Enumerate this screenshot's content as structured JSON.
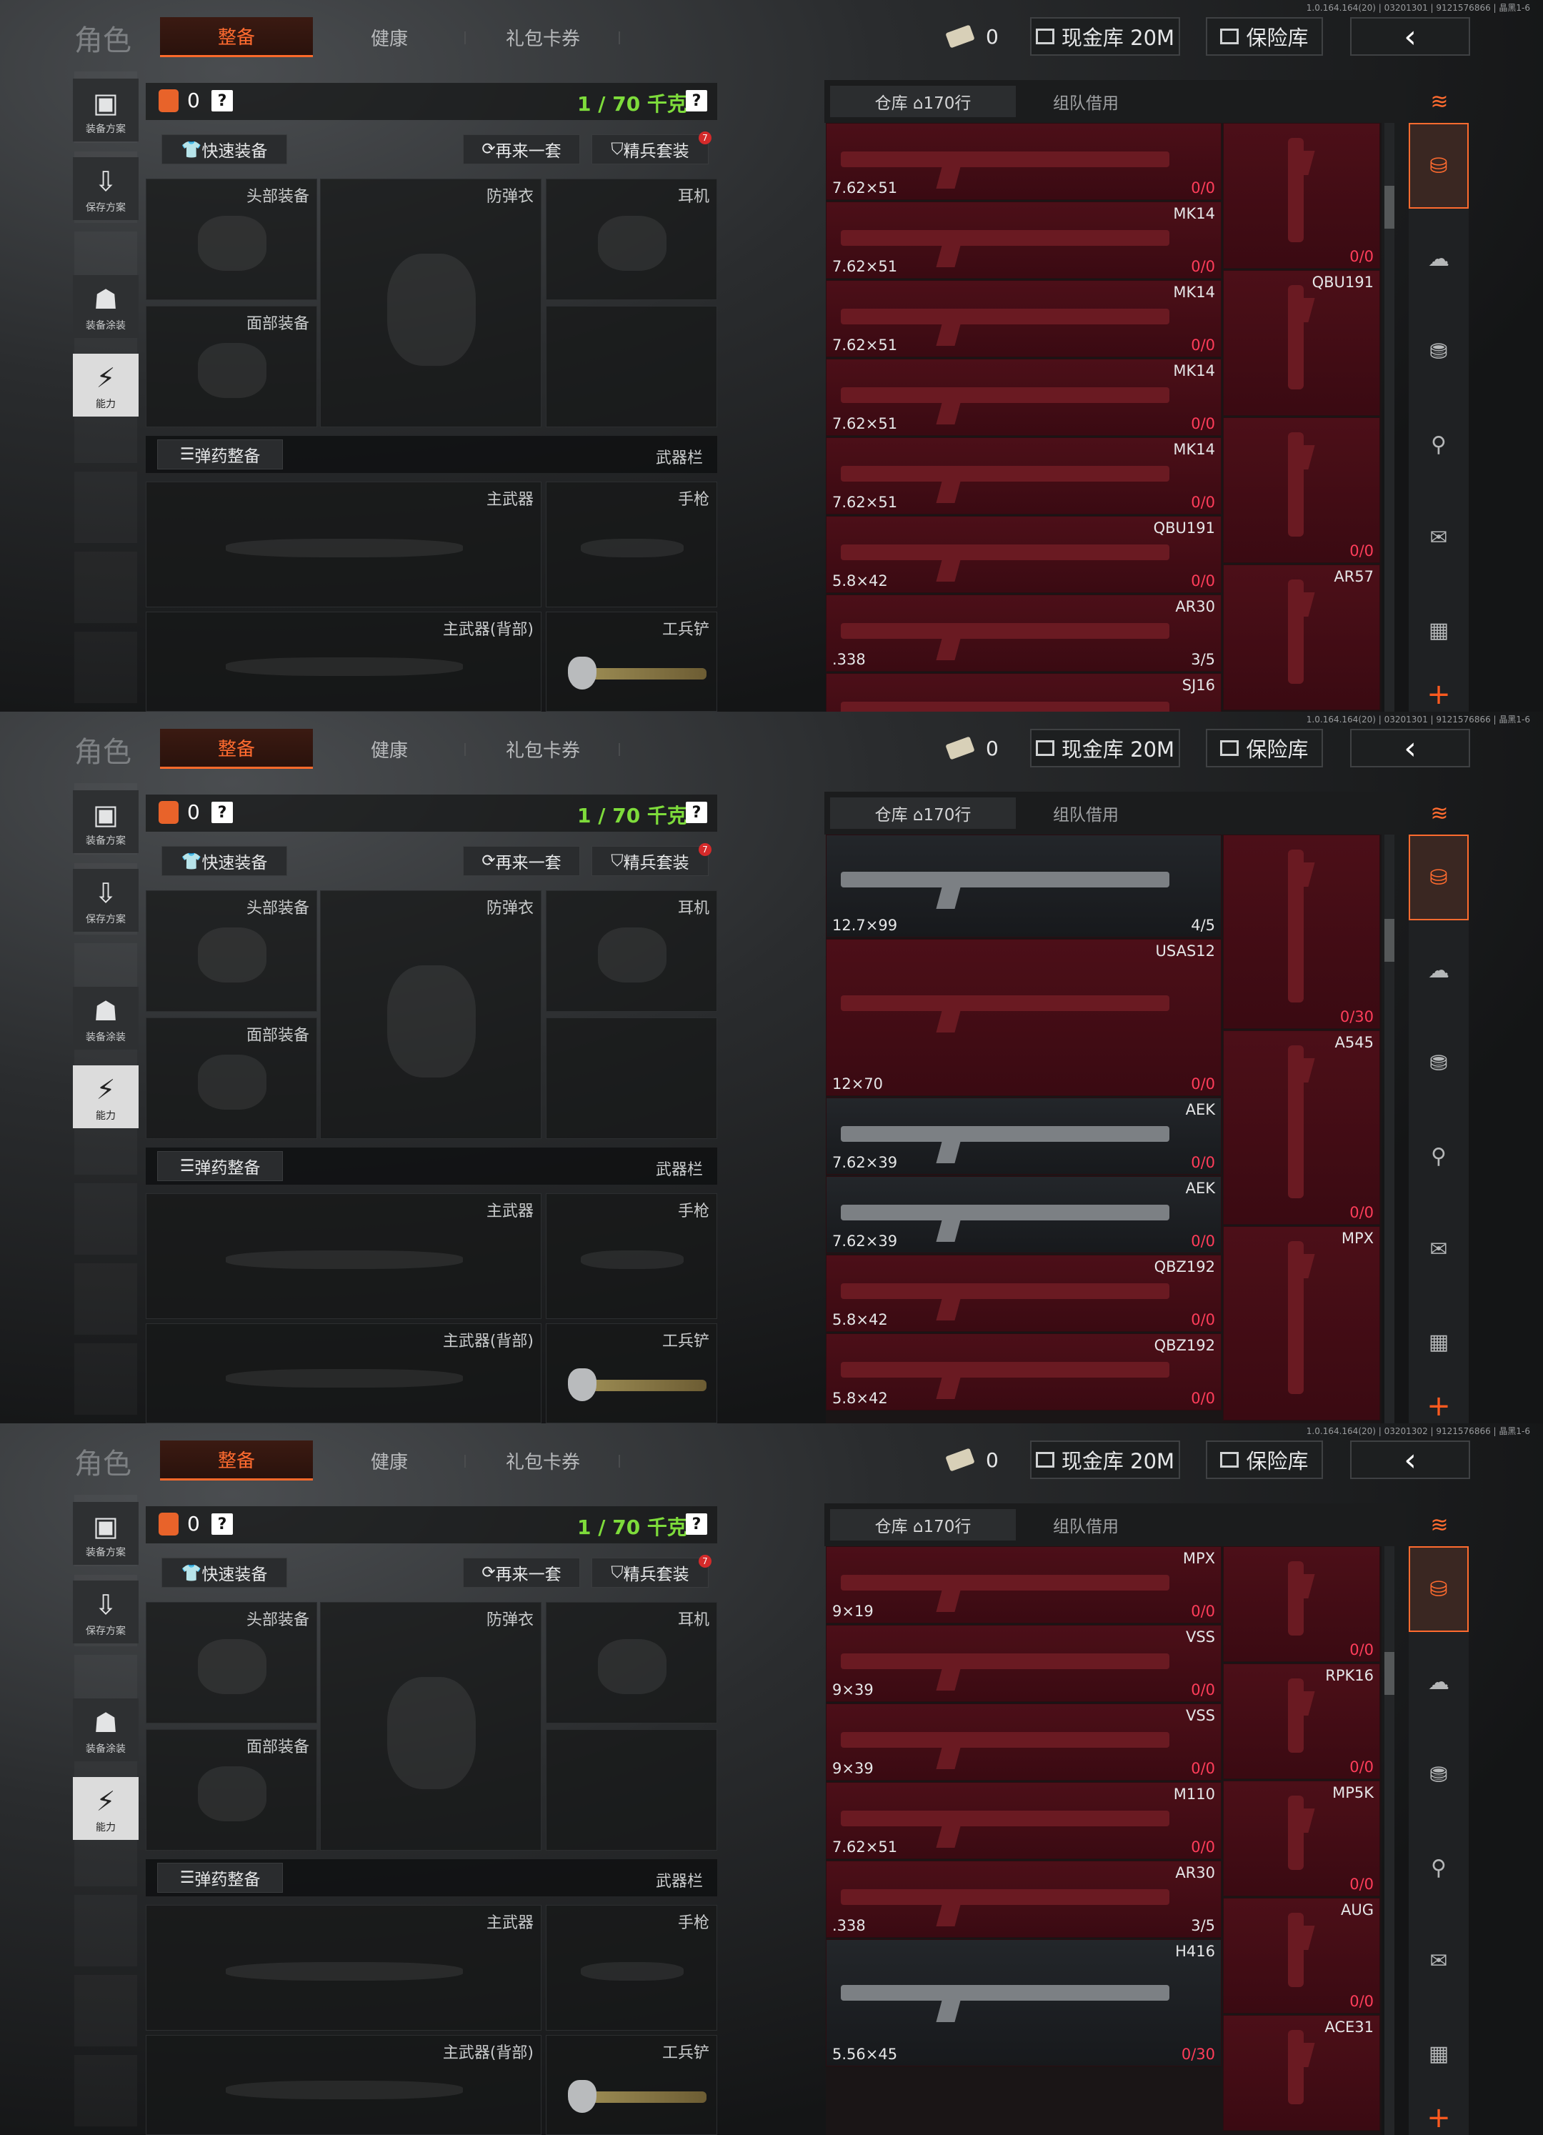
{
  "panels": [
    {
      "version": "1.0.164.164(20) | 03201301 | 9121576866 | 晶黑1-6",
      "header": {
        "title": "角色",
        "tabs": [
          "整备",
          "健康",
          "礼包卡券"
        ],
        "money": "0",
        "cash_label": "现金库 20M",
        "safe_label": "保险库",
        "back_icon": "‹"
      },
      "side": [
        "装备方案",
        "保存方案",
        "装备涂装",
        "能力"
      ],
      "loadout": {
        "count": "0",
        "help": "?",
        "weight": "1 / 70 千克",
        "quick": "快速装备",
        "again": "再来一套",
        "elite": "精兵套装",
        "badge": "7"
      },
      "slots": {
        "head": "头部装备",
        "armor": "防弹衣",
        "ear": "耳机",
        "face": "面部装备",
        "ammo": "弹药整备",
        "weapons": "武器栏",
        "primary": "主武器",
        "pistol": "手枪",
        "back": "主武器(背部)",
        "shovel": "工兵铲"
      },
      "warehouse": {
        "tab1": "仓库 ⌂170行",
        "tab2": "组队借用"
      },
      "cards": [
        {
          "name": "",
          "cal": "7.62×51",
          "ammo": "0/0"
        },
        {
          "name": "MK14",
          "cal": "7.62×51",
          "ammo": "0/0"
        },
        {
          "name": "MK14",
          "cal": "7.62×51",
          "ammo": "0/0"
        },
        {
          "name": "MK14",
          "cal": "7.62×51",
          "ammo": "0/0"
        },
        {
          "name": "MK14",
          "cal": "7.62×51",
          "ammo": "0/0"
        },
        {
          "name": "QBU191",
          "cal": "5.8×42",
          "ammo": "0/0"
        },
        {
          "name": "AR30",
          "cal": ".338",
          "ammo": "3/5"
        },
        {
          "name": "SJ16",
          "cal": "",
          "ammo": ""
        }
      ],
      "col2": [
        {
          "name": "",
          "ammo": "0/0"
        },
        {
          "name": "QBU191",
          "ammo": ""
        },
        {
          "name": "",
          "ammo": "0/0"
        },
        {
          "name": "AR57",
          "ammo": ""
        }
      ]
    },
    {
      "version": "1.0.164.164(20) | 03201301 | 9121576866 | 晶黑1-6",
      "header": {
        "title": "角色",
        "tabs": [
          "整备",
          "健康",
          "礼包卡券"
        ],
        "money": "0",
        "cash_label": "现金库 20M",
        "safe_label": "保险库",
        "back_icon": "‹"
      },
      "side": [
        "装备方案",
        "保存方案",
        "装备涂装",
        "能力"
      ],
      "loadout": {
        "count": "0",
        "help": "?",
        "weight": "1 / 70 千克",
        "quick": "快速装备",
        "again": "再来一套",
        "elite": "精兵套装",
        "badge": "7"
      },
      "slots": {
        "head": "头部装备",
        "armor": "防弹衣",
        "ear": "耳机",
        "face": "面部装备",
        "ammo": "弹药整备",
        "weapons": "武器栏",
        "primary": "主武器",
        "pistol": "手枪",
        "back": "主武器(背部)",
        "shovel": "工兵铲"
      },
      "warehouse": {
        "tab1": "仓库 ⌂170行",
        "tab2": "组队借用"
      },
      "cards": [
        {
          "name": "",
          "cal": "12.7×99",
          "ammo": "4/5"
        },
        {
          "name": "USAS12",
          "cal": "12×70",
          "ammo": "0/0"
        },
        {
          "name": "AEK",
          "cal": "7.62×39",
          "ammo": "0/0"
        },
        {
          "name": "AEK",
          "cal": "7.62×39",
          "ammo": "0/0"
        },
        {
          "name": "QBZ192",
          "cal": "5.8×42",
          "ammo": "0/0"
        },
        {
          "name": "QBZ192",
          "cal": "5.8×42",
          "ammo": "0/0"
        }
      ],
      "col2": [
        {
          "name": "",
          "ammo": "0/30"
        },
        {
          "name": "A545",
          "ammo": "0/0"
        },
        {
          "name": "MPX",
          "ammo": ""
        }
      ]
    },
    {
      "version": "1.0.164.164(20) | 03201302 | 9121576866 | 晶黑1-6",
      "header": {
        "title": "角色",
        "tabs": [
          "整备",
          "健康",
          "礼包卡券"
        ],
        "money": "0",
        "cash_label": "现金库 20M",
        "safe_label": "保险库",
        "back_icon": "‹"
      },
      "side": [
        "装备方案",
        "保存方案",
        "装备涂装",
        "能力"
      ],
      "loadout": {
        "count": "0",
        "help": "?",
        "weight": "1 / 70 千克",
        "quick": "快速装备",
        "again": "再来一套",
        "elite": "精兵套装",
        "badge": "7"
      },
      "slots": {
        "head": "头部装备",
        "armor": "防弹衣",
        "ear": "耳机",
        "face": "面部装备",
        "ammo": "弹药整备",
        "weapons": "武器栏",
        "primary": "主武器",
        "pistol": "手枪",
        "back": "主武器(背部)",
        "shovel": "工兵铲"
      },
      "warehouse": {
        "tab1": "仓库 ⌂170行",
        "tab2": "组队借用"
      },
      "cards": [
        {
          "name": "MPX",
          "cal": "9×19",
          "ammo": "0/0"
        },
        {
          "name": "VSS",
          "cal": "9×39",
          "ammo": "0/0"
        },
        {
          "name": "VSS",
          "cal": "9×39",
          "ammo": "0/0"
        },
        {
          "name": "M110",
          "cal": "7.62×51",
          "ammo": "0/0"
        },
        {
          "name": "AR30",
          "cal": ".338",
          "ammo": "3/5"
        },
        {
          "name": "H416",
          "cal": "5.56×45",
          "ammo": "0/30"
        }
      ],
      "col2": [
        {
          "name": "",
          "ammo": "0/0"
        },
        {
          "name": "RPK16",
          "ammo": "0/0"
        },
        {
          "name": "MP5K",
          "ammo": "0/0"
        },
        {
          "name": "AUG",
          "ammo": "0/0"
        },
        {
          "name": "ACE31",
          "ammo": ""
        }
      ]
    }
  ],
  "colors": {
    "accent": "#ff6b2f",
    "weight": "#7edc3b",
    "ammo_red": "#ff3d5a",
    "card_red": "#4c0f18"
  }
}
